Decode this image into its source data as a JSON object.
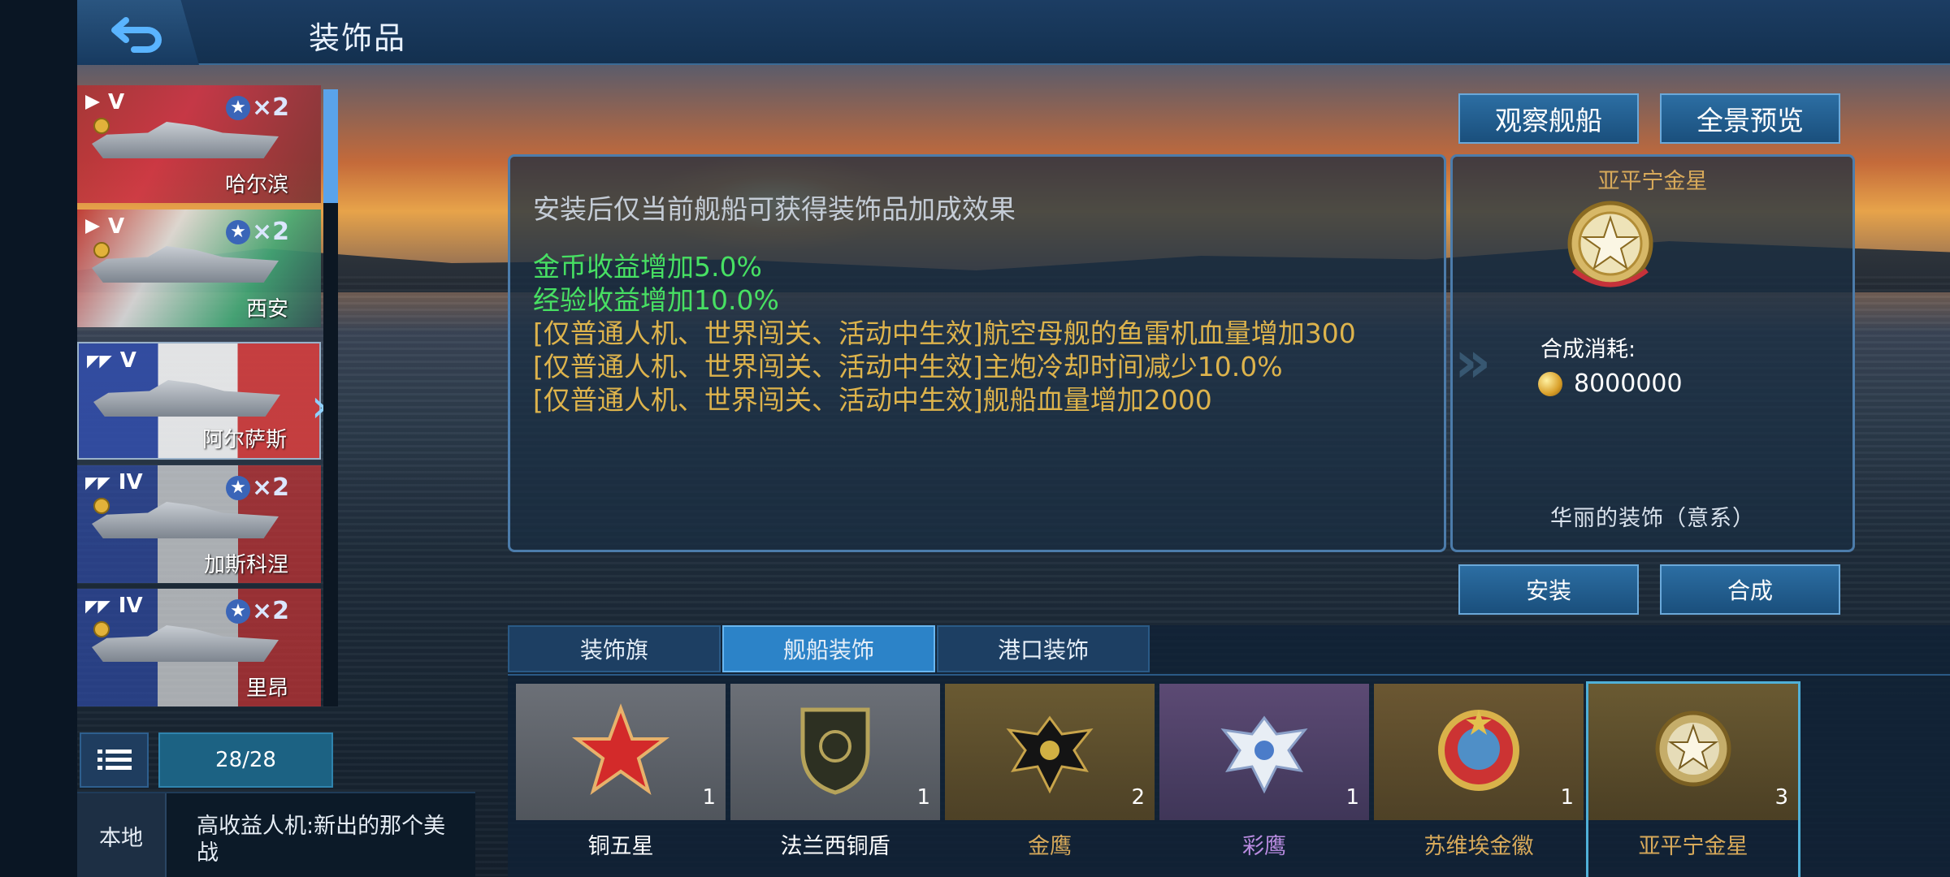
{
  "header": {
    "title": "装饰品"
  },
  "ships": [
    {
      "tier": "V",
      "name": "哈尔滨",
      "stars": "×2"
    },
    {
      "tier": "V",
      "name": "西安",
      "stars": "×2"
    },
    {
      "tier": "V",
      "name": "阿尔萨斯"
    },
    {
      "tier": "IV",
      "name": "加斯科涅",
      "stars": "×2"
    },
    {
      "tier": "IV",
      "name": "里昂",
      "stars": "×2"
    }
  ],
  "list": {
    "count": "28/28"
  },
  "chat": {
    "tab": "本地",
    "message": "高收益人机:新出的那个美战"
  },
  "info": {
    "hint": "安装后仅当前舰船可获得装饰品加成效果",
    "effects_green": [
      "金币收益增加5.0%",
      "经验收益增加10.0%"
    ],
    "effects_gold": [
      "[仅普通人机、世界闯关、活动中生效]航空母舰的鱼雷机血量增加300",
      "[仅普通人机、世界闯关、活动中生效]主炮冷却时间减少10.0%",
      "[仅普通人机、世界闯关、活动中生效]舰船血量增加2000"
    ]
  },
  "item": {
    "name": "亚平宁金星",
    "cost_label": "合成消耗:",
    "cost_value": "8000000",
    "subtitle": "华丽的装饰（意系）"
  },
  "buttons": {
    "observe": "观察舰船",
    "panorama": "全景预览",
    "install": "安装",
    "compose": "合成"
  },
  "tabs": [
    "装饰旗",
    "舰船装饰",
    "港口装饰"
  ],
  "active_tab": "舰船装饰",
  "items": [
    {
      "label": "铜五星",
      "count": "1",
      "label_color": "#ffffff",
      "icon": "red-star-icon"
    },
    {
      "label": "法兰西铜盾",
      "count": "1",
      "label_color": "#ffffff",
      "icon": "shield-icon"
    },
    {
      "label": "金鹰",
      "count": "2",
      "label_color": "#d7a95a",
      "icon": "eagle-icon"
    },
    {
      "label": "彩鹰",
      "count": "1",
      "label_color": "#b88be0",
      "icon": "eagle-icon"
    },
    {
      "label": "苏维埃金徽",
      "count": "1",
      "label_color": "#d7a95a",
      "icon": "soviet-emblem-icon"
    },
    {
      "label": "亚平宁金星",
      "count": "3",
      "label_color": "#d7a95a",
      "icon": "gold-star-emblem-icon"
    }
  ]
}
